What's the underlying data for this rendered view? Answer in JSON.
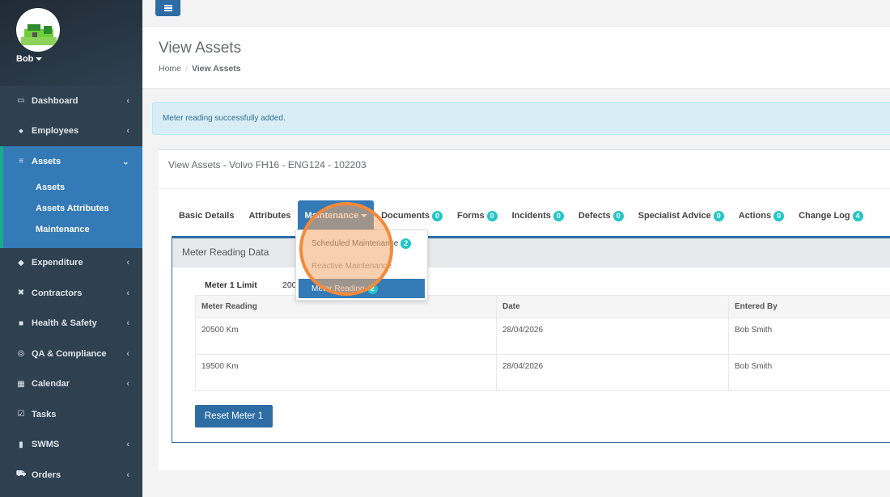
{
  "sidebar": {
    "user": {
      "name": "Bob"
    },
    "items": [
      {
        "label": "Dashboard",
        "icon": "monitor-icon",
        "glyph": "▭",
        "chevron": "‹"
      },
      {
        "label": "Employees",
        "icon": "user-icon",
        "glyph": "●",
        "chevron": "‹"
      },
      {
        "label": "Assets",
        "icon": "list-icon",
        "glyph": "≡",
        "chevron": "⌄"
      },
      {
        "label": "Expenditure",
        "icon": "tag-icon",
        "glyph": "◆",
        "chevron": "‹"
      },
      {
        "label": "Contractors",
        "icon": "tools-icon",
        "glyph": "✖",
        "chevron": "‹"
      },
      {
        "label": "Health & Safety",
        "icon": "medkit-icon",
        "glyph": "■",
        "chevron": "‹"
      },
      {
        "label": "QA & Compliance",
        "icon": "compass-icon",
        "glyph": "◎",
        "chevron": "‹"
      },
      {
        "label": "Calendar",
        "icon": "calendar-icon",
        "glyph": "▦",
        "chevron": "‹"
      },
      {
        "label": "Tasks",
        "icon": "checkbox-icon",
        "glyph": "☑",
        "chevron": ""
      },
      {
        "label": "SWMS",
        "icon": "truck-icon",
        "glyph": "▮",
        "chevron": "‹"
      },
      {
        "label": "Orders",
        "icon": "cart-icon",
        "glyph": "⛟",
        "chevron": "‹"
      }
    ],
    "asset_sub": [
      "Assets",
      "Assets Attributes",
      "Maintenance"
    ]
  },
  "header": {
    "title": "View Assets",
    "breadcrumb": {
      "home": "Home",
      "sep": "/",
      "current": "View Assets"
    }
  },
  "alert": {
    "text": "Meter reading successfully added."
  },
  "panel": {
    "title": "View Assets - Volvo FH16 - ENG124 - 102203",
    "tabs": [
      {
        "label": "Basic Details"
      },
      {
        "label": "Attributes"
      },
      {
        "label": "Maintenance"
      },
      {
        "label": "Documents",
        "badge": "0"
      },
      {
        "label": "Forms",
        "badge": "0"
      },
      {
        "label": "Incidents",
        "badge": "0"
      },
      {
        "label": "Defects",
        "badge": "0"
      },
      {
        "label": "Specialist Advice",
        "badge": "0"
      },
      {
        "label": "Actions",
        "badge": "0"
      },
      {
        "label": "Change Log",
        "badge": "4"
      }
    ],
    "content_title": "Meter Reading Data",
    "limit_label": "Meter 1 Limit",
    "limit_value": "200",
    "table": {
      "headers": [
        "Meter Reading",
        "Date",
        "Entered By"
      ],
      "rows": [
        [
          "20500 Km",
          "28/04/2026",
          "Bob Smith"
        ],
        [
          "19500 Km",
          "28/04/2026",
          "Bob Smith"
        ]
      ]
    },
    "reset_button": "Reset Meter 1"
  },
  "dropdown": {
    "items": [
      {
        "label": "Scheduled Maintenance",
        "badge": "2"
      },
      {
        "label": "Reactive Maintenance"
      },
      {
        "label": "Meter Reading",
        "badge": "2"
      }
    ]
  },
  "colors": {
    "sidebar_bg": "#2f4050",
    "accent": "#337ab7",
    "badge": "#23c6c8",
    "highlight": "#f48a3a"
  }
}
